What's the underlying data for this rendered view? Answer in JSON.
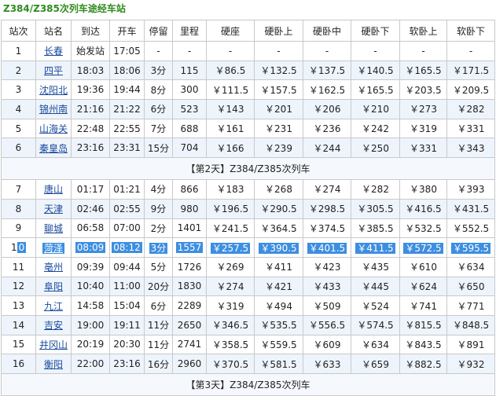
{
  "title": "Z384/Z385次列车途经车站",
  "headers": [
    "站次",
    "站名",
    "到达",
    "开车",
    "停留",
    "里程",
    "硬座",
    "硬卧上",
    "硬卧中",
    "硬卧下",
    "软卧上",
    "软卧下"
  ],
  "rows1": [
    [
      "1",
      "长春",
      "始发站",
      "17:05",
      "-",
      "-",
      "-",
      "-",
      "-",
      "-",
      "-",
      "-"
    ],
    [
      "2",
      "四平",
      "18:03",
      "18:06",
      "3分",
      "115",
      "￥86.5",
      "￥132.5",
      "￥137.5",
      "￥140.5",
      "￥165.5",
      "￥171.5"
    ],
    [
      "3",
      "沈阳北",
      "19:36",
      "19:44",
      "8分",
      "300",
      "￥111.5",
      "￥157.5",
      "￥162.5",
      "￥165.5",
      "￥203.5",
      "￥209.5"
    ],
    [
      "4",
      "锦州南",
      "21:16",
      "21:22",
      "6分",
      "523",
      "￥143",
      "￥201",
      "￥206",
      "￥210",
      "￥273",
      "￥282"
    ],
    [
      "5",
      "山海关",
      "22:48",
      "22:55",
      "7分",
      "688",
      "￥161",
      "￥231",
      "￥236",
      "￥242",
      "￥319",
      "￥331"
    ],
    [
      "6",
      "秦皇岛",
      "23:16",
      "23:31",
      "15分",
      "704",
      "￥166",
      "￥239",
      "￥244",
      "￥250",
      "￥331",
      "￥343"
    ]
  ],
  "sep1": "【第2天】Z384/Z385次列车",
  "rows2": [
    [
      "7",
      "唐山",
      "01:17",
      "01:21",
      "4分",
      "866",
      "￥183",
      "￥268",
      "￥274",
      "￥282",
      "￥380",
      "￥393"
    ],
    [
      "8",
      "天津",
      "02:46",
      "02:55",
      "9分",
      "980",
      "￥196.5",
      "￥290.5",
      "￥298.5",
      "￥305.5",
      "￥416.5",
      "￥431.5"
    ],
    [
      "9",
      "聊城",
      "06:58",
      "07:00",
      "2分",
      "1401",
      "￥241.5",
      "￥364.5",
      "￥374.5",
      "￥385.5",
      "￥532.5",
      "￥552.5"
    ],
    [
      "10",
      "菏泽",
      "08:09",
      "08:12",
      "3分",
      "1557",
      "￥257.5",
      "￥390.5",
      "￥401.5",
      "￥411.5",
      "￥572.5",
      "￥595.5"
    ],
    [
      "11",
      "亳州",
      "09:39",
      "09:44",
      "5分",
      "1726",
      "￥269",
      "￥411",
      "￥423",
      "￥435",
      "￥610",
      "￥634"
    ],
    [
      "12",
      "阜阳",
      "10:40",
      "11:00",
      "20分",
      "1830",
      "￥274",
      "￥421",
      "￥433",
      "￥445",
      "￥624",
      "￥650"
    ],
    [
      "13",
      "九江",
      "14:58",
      "15:04",
      "6分",
      "2289",
      "￥319",
      "￥494",
      "￥509",
      "￥524",
      "￥741",
      "￥771"
    ],
    [
      "14",
      "吉安",
      "19:00",
      "19:11",
      "11分",
      "2650",
      "￥346.5",
      "￥535.5",
      "￥556.5",
      "￥574.5",
      "￥815.5",
      "￥848.5"
    ],
    [
      "15",
      "井冈山",
      "20:19",
      "20:30",
      "11分",
      "2741",
      "￥358.5",
      "￥559.5",
      "￥609",
      "￥634",
      "￥843.5",
      "￥891"
    ],
    [
      "16",
      "衡阳",
      "22:00",
      "23:16",
      "16分",
      "2960",
      "￥370.5",
      "￥581.5",
      "￥633",
      "￥659",
      "￥882.5",
      "￥932"
    ]
  ],
  "sep2": "【第3天】Z384/Z385次列车",
  "selected_row_index": 9
}
